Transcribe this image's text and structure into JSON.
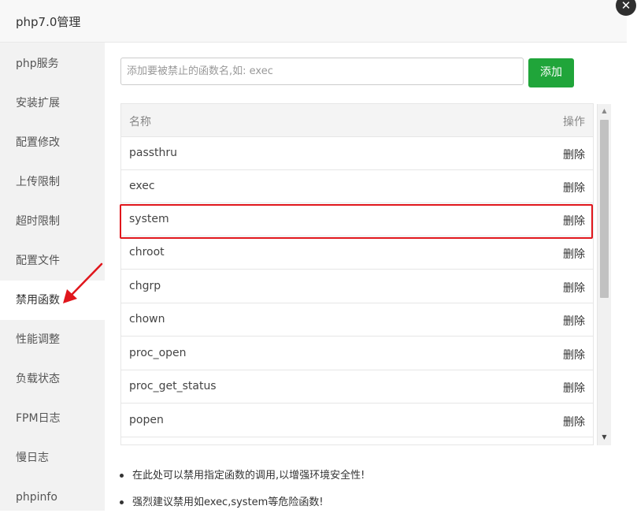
{
  "window": {
    "title": "php7.0管理",
    "close_glyph": "✕"
  },
  "sidebar": {
    "items": [
      {
        "label": "php服务"
      },
      {
        "label": "安装扩展"
      },
      {
        "label": "配置修改"
      },
      {
        "label": "上传限制"
      },
      {
        "label": "超时限制"
      },
      {
        "label": "配置文件"
      },
      {
        "label": "禁用函数",
        "active": true
      },
      {
        "label": "性能调整"
      },
      {
        "label": "负载状态"
      },
      {
        "label": "FPM日志"
      },
      {
        "label": "慢日志"
      },
      {
        "label": "phpinfo"
      }
    ]
  },
  "form": {
    "input_value": "",
    "input_placeholder": "添加要被禁止的函数名,如: exec",
    "add_label": "添加",
    "accent_color": "#20a53a"
  },
  "table": {
    "headers": {
      "name": "名称",
      "action": "操作"
    },
    "rows": [
      {
        "name": "passthru",
        "action": "删除"
      },
      {
        "name": "exec",
        "action": "删除"
      },
      {
        "name": "system",
        "action": "删除",
        "highlighted": true
      },
      {
        "name": "chroot",
        "action": "删除"
      },
      {
        "name": "chgrp",
        "action": "删除"
      },
      {
        "name": "chown",
        "action": "删除"
      },
      {
        "name": "proc_open",
        "action": "删除"
      },
      {
        "name": "proc_get_status",
        "action": "删除"
      },
      {
        "name": "popen",
        "action": "删除"
      },
      {
        "name": "",
        "action": ""
      }
    ]
  },
  "notes": [
    "在此处可以禁用指定函数的调用,以增强环境安全性!",
    "强烈建议禁用如exec,system等危险函数!"
  ],
  "annotation": {
    "color": "#e0161c"
  },
  "icons": {
    "close": "close-icon",
    "scroll_up": "chevron-up-icon",
    "scroll_down": "chevron-down-icon",
    "arrow": "red-arrow-annotation"
  }
}
